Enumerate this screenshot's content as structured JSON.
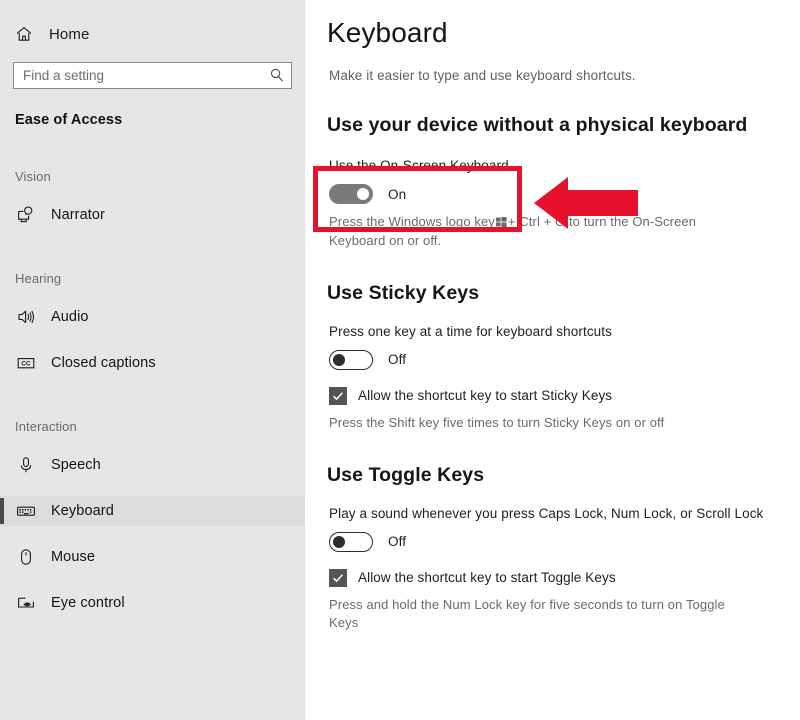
{
  "sidebar": {
    "home": {
      "label": "Home",
      "icon": "home-icon"
    },
    "search": {
      "placeholder": "Find a setting",
      "value": "",
      "icon": "search-icon"
    },
    "category_title": "Ease of Access",
    "groups": [
      {
        "header": "Vision",
        "items": [
          {
            "label": "Narrator",
            "icon": "narrator-icon",
            "selected": false
          }
        ]
      },
      {
        "header": "Hearing",
        "items": [
          {
            "label": "Audio",
            "icon": "audio-icon",
            "selected": false
          },
          {
            "label": "Closed captions",
            "icon": "closed-captions-icon",
            "selected": false
          }
        ]
      },
      {
        "header": "Interaction",
        "items": [
          {
            "label": "Speech",
            "icon": "microphone-icon",
            "selected": false
          },
          {
            "label": "Keyboard",
            "icon": "keyboard-icon",
            "selected": true
          },
          {
            "label": "Mouse",
            "icon": "mouse-icon",
            "selected": false
          },
          {
            "label": "Eye control",
            "icon": "eye-control-icon",
            "selected": false
          }
        ]
      }
    ]
  },
  "main": {
    "title": "Keyboard",
    "subtitle": "Make it easier to type and use keyboard shortcuts.",
    "sections": {
      "onscreen_keyboard": {
        "heading": "Use your device without a physical keyboard",
        "setting_label": "Use the On-Screen Keyboard",
        "toggle_state": "On",
        "hint_before_key": "Press the Windows logo key",
        "hint_after_key": "+ Ctrl + O to turn the On-Screen Keyboard on or off."
      },
      "sticky_keys": {
        "heading": "Use Sticky Keys",
        "setting_label": "Press one key at a time for keyboard shortcuts",
        "toggle_state": "Off",
        "checkbox_label": "Allow the shortcut key to start Sticky Keys",
        "checkbox_checked": true,
        "hint": "Press the Shift key five times to turn Sticky Keys on or off"
      },
      "toggle_keys": {
        "heading": "Use Toggle Keys",
        "setting_label": "Play a sound whenever you press Caps Lock, Num Lock, or Scroll Lock",
        "toggle_state": "Off",
        "checkbox_label": "Allow the shortcut key to start Toggle Keys",
        "checkbox_checked": true,
        "hint": "Press and hold the Num Lock key for five seconds to turn on Toggle Keys"
      }
    }
  },
  "annotations": {
    "highlight_color": "#e8112d",
    "box_target": "Use the On-Screen Keyboard toggle",
    "arrow_direction": "left"
  }
}
